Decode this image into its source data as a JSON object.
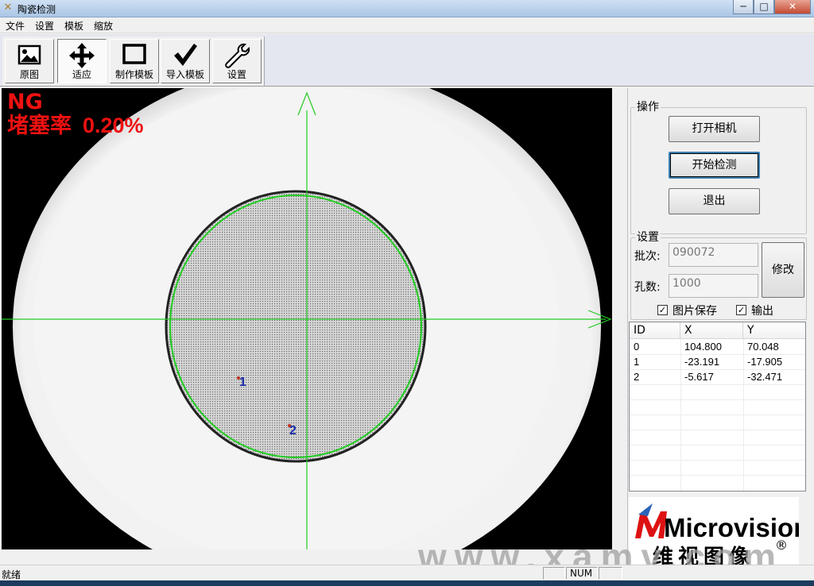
{
  "window": {
    "title": "陶瓷检测"
  },
  "menu": [
    "文件",
    "设置",
    "模板",
    "缩放"
  ],
  "toolbar": {
    "buttons": [
      {
        "label": "原图",
        "icon": "picture-icon"
      },
      {
        "label": "适应",
        "icon": "move-arrows-icon"
      },
      {
        "label": "制作模板",
        "icon": "rectangle-icon"
      },
      {
        "label": "导入模板",
        "icon": "checkmark-icon"
      },
      {
        "label": "设置",
        "icon": "wrench-icon"
      }
    ]
  },
  "overlay": {
    "status": "NG",
    "block_rate_label": "堵塞率",
    "block_rate_value": "0.20%",
    "markers": [
      "1",
      "2"
    ]
  },
  "panel": {
    "operation": {
      "legend": "操作",
      "open_camera": "打开相机",
      "start_detect": "开始检测",
      "exit": "退出"
    },
    "settings": {
      "legend": "设置",
      "batch_label": "批次:",
      "batch_value": "090072",
      "holes_label": "孔数:",
      "holes_value": "1000",
      "modify_button": "修改",
      "save_image_label": "图片保存",
      "save_image_checked": true,
      "output_label": "输出",
      "output_checked": true
    },
    "table": {
      "headers": [
        "ID",
        "X",
        "Y"
      ],
      "rows": [
        [
          "0",
          "104.800",
          "70.048"
        ],
        [
          "1",
          "-23.191",
          "-17.905"
        ],
        [
          "2",
          "-5.617",
          "-32.471"
        ]
      ]
    },
    "logo": {
      "brand": "Microvision",
      "chinese": "维视图像",
      "mark": "®"
    }
  },
  "watermark": "www.xamv.com",
  "statusbar": {
    "text": "就绪",
    "num": "NUM"
  }
}
